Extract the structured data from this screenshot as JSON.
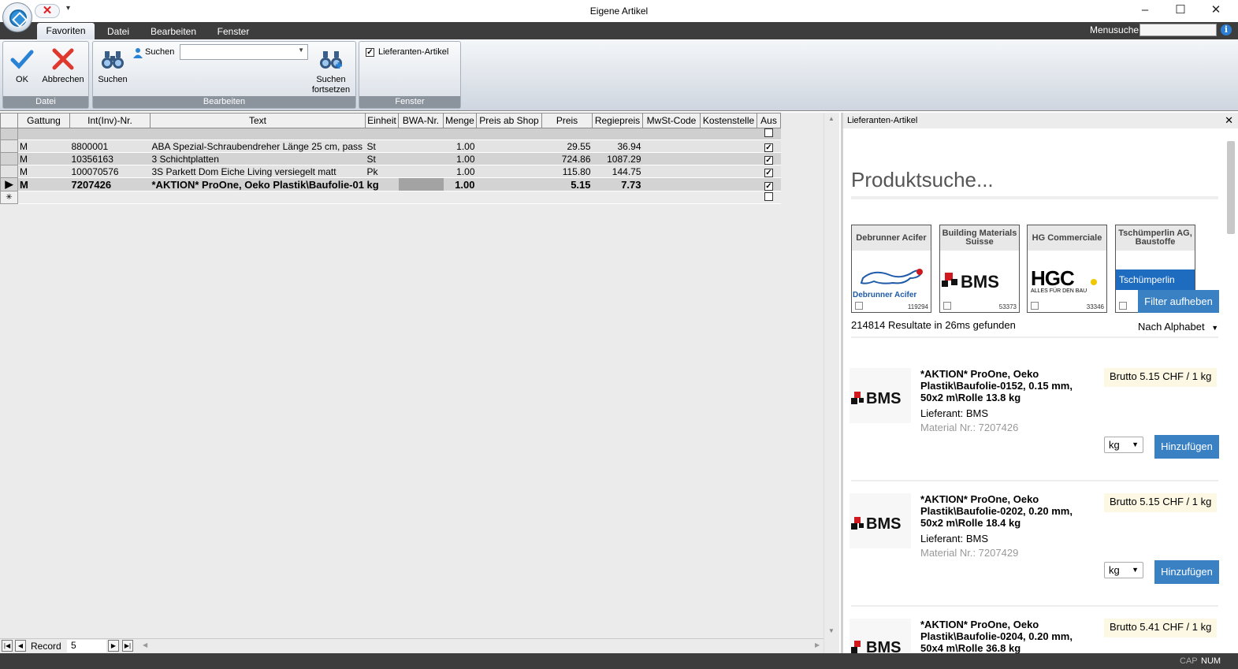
{
  "window": {
    "title": "Eigene Artikel",
    "minimize": "–",
    "maximize": "☐",
    "close": "✕"
  },
  "quick_access": {
    "close_symbol": "✕",
    "more_symbol": "▾"
  },
  "ribbon_tabs": [
    {
      "label": "Favoriten",
      "active": true
    },
    {
      "label": "Datei",
      "active": false
    },
    {
      "label": "Bearbeiten",
      "active": false
    },
    {
      "label": "Fenster",
      "active": false
    }
  ],
  "menusuche": {
    "label": "Menusuche",
    "value": "",
    "help": "i"
  },
  "ribbon": {
    "datei": {
      "label": "Datei",
      "ok": "OK",
      "abbrechen": "Abbrechen"
    },
    "bearbeiten": {
      "label": "Bearbeiten",
      "suchen": "Suchen",
      "suchen_field_label": "Suchen",
      "suchen_value": "",
      "fortsetzen_line1": "Suchen",
      "fortsetzen_line2": "fortsetzen"
    },
    "fenster": {
      "label": "Fenster",
      "lieferanten_artikel": "Lieferanten-Artikel",
      "lieferanten_checked": true
    }
  },
  "grid": {
    "columns": [
      "Gattung",
      "Int(Inv)-Nr.",
      "Text",
      "Einheit",
      "BWA-Nr.",
      "Menge",
      "Preis ab Shop",
      "Preis",
      "Regiepreis",
      "MwSt-Code",
      "Kostenstelle",
      "Aus"
    ],
    "rows": [
      {
        "gattung": "M",
        "nr": "8800001",
        "text": "ABA Spezial-Schraubendreher Länge 25 cm, pass",
        "einheit": "St",
        "bwa": "",
        "menge": "1.00",
        "shop": "",
        "preis": "29.55",
        "regie": "36.94",
        "mwst": "",
        "kst": "",
        "aus": true
      },
      {
        "gattung": "M",
        "nr": "10356163",
        "text": "3 Schichtplatten",
        "einheit": "St",
        "bwa": "",
        "menge": "1.00",
        "shop": "",
        "preis": "724.86",
        "regie": "1087.29",
        "mwst": "",
        "kst": "",
        "aus": true
      },
      {
        "gattung": "M",
        "nr": "100070576",
        "text": "3S Parkett Dom Eiche Living versiegelt matt",
        "einheit": "Pk",
        "bwa": "",
        "menge": "1.00",
        "shop": "",
        "preis": "115.80",
        "regie": "144.75",
        "mwst": "",
        "kst": "",
        "aus": true
      },
      {
        "gattung": "M",
        "nr": "7207426",
        "text": "*AKTION* ProOne, Oeko Plastik\\Baufolie-01",
        "einheit": "kg",
        "bwa": "",
        "menge": "1.00",
        "shop": "",
        "preis": "5.15",
        "regie": "7.73",
        "mwst": "",
        "kst": "",
        "aus": true
      }
    ],
    "current_marker": "▶",
    "new_marker": "✳"
  },
  "navigator": {
    "label": "Record",
    "value": "5"
  },
  "right_panel": {
    "title": "Lieferanten-Artikel",
    "close": "✕",
    "search_heading": "Produktsuche...",
    "suppliers": [
      {
        "name": "Debrunner Acifer",
        "logo_text": "Debrunner Acifer",
        "count": "119294"
      },
      {
        "name": "Building Materials Suisse",
        "logo_text": "BMS",
        "count": "53373"
      },
      {
        "name": "HG Commerciale",
        "logo_text": "HGC",
        "logo_sub": "ALLES FÜR DEN BAU",
        "count": "33346"
      },
      {
        "name": "Tschümperlin AG, Baustoffe",
        "logo_text": "Tschümperlin",
        "count": ""
      }
    ],
    "filter_button": "Filter aufheben",
    "results_text": "214814 Resultate in 26ms gefunden",
    "sort_label": "Nach Alphabet",
    "items": [
      {
        "title": "*AKTION* ProOne, Oeko Plastik\\Baufolie-0152, 0.15 mm, 50x2 m\\Rolle 13.8 kg",
        "supplier": "Lieferant: BMS",
        "material": "Material Nr.: 7207426",
        "price": "Brutto 5.15 CHF / 1 kg",
        "unit": "kg",
        "add": "Hinzufügen",
        "logo": "BMS"
      },
      {
        "title": "*AKTION* ProOne, Oeko Plastik\\Baufolie-0202, 0.20 mm, 50x2 m\\Rolle 18.4 kg",
        "supplier": "Lieferant: BMS",
        "material": "Material Nr.: 7207429",
        "price": "Brutto 5.15 CHF / 1 kg",
        "unit": "kg",
        "add": "Hinzufügen",
        "logo": "BMS"
      },
      {
        "title": "*AKTION* ProOne, Oeko Plastik\\Baufolie-0204, 0.20 mm, 50x4 m\\Rolle 36.8 kg",
        "supplier": "",
        "material": "",
        "price": "Brutto 5.41 CHF / 1 kg",
        "unit": "",
        "add": "",
        "logo": "BMS"
      }
    ]
  },
  "status": {
    "cap": "CAP",
    "num": "NUM"
  },
  "colors": {
    "accent": "#3a81c4",
    "tab_bar": "#3d3d3d",
    "price_bg": "#fcf8e3",
    "bms_red": "#d0181f"
  }
}
